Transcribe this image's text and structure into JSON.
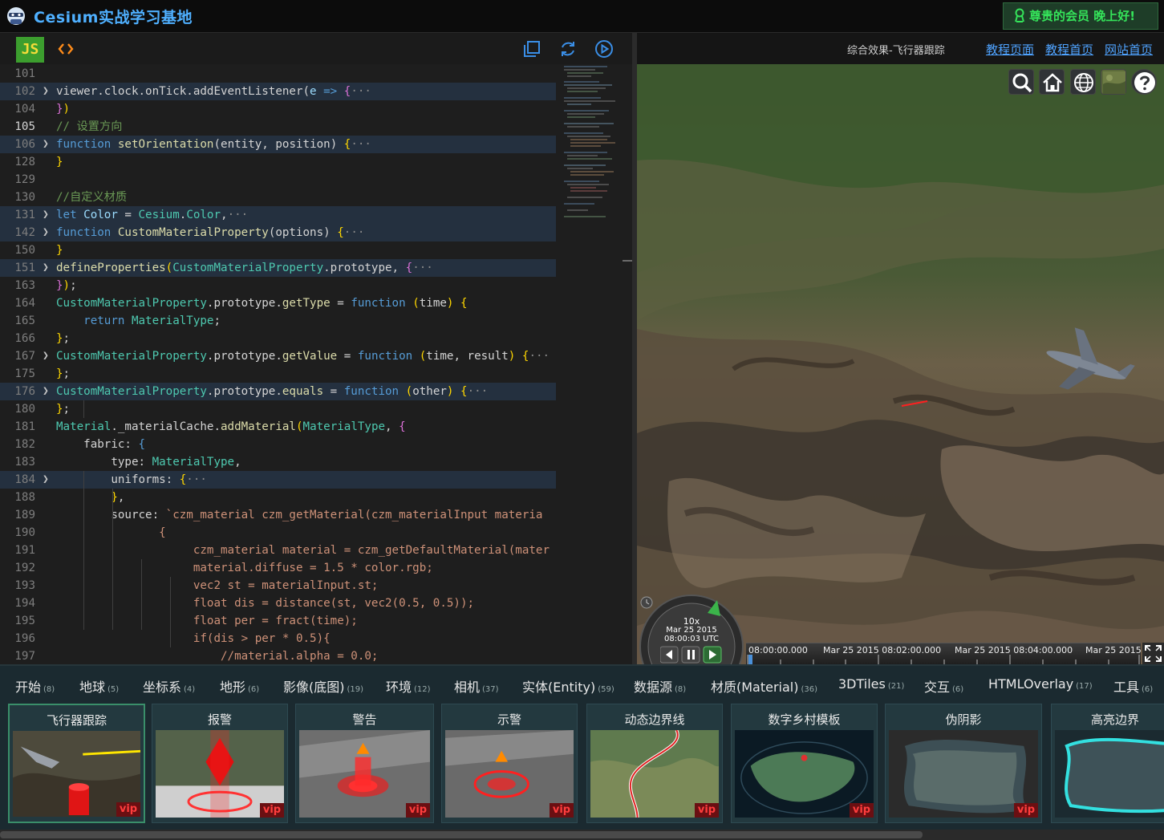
{
  "header": {
    "app_title": "Cesium实战学习基地",
    "member_text": "尊贵的会员 晚上好!",
    "logo_icon": "mascot-logo-icon",
    "member_icon": "user-badge-icon"
  },
  "editor": {
    "lang_badge": "JS",
    "toolbar_icons": [
      "code-icon",
      "copy-icon",
      "refresh-icon",
      "run-icon"
    ],
    "lines": [
      {
        "n": "101",
        "html": ""
      },
      {
        "n": "102",
        "fold": true,
        "hl": true,
        "html": "viewer.clock.onTick.addEventListener(<span class='par'>e</span> <span class='kw'>=&gt;</span> <span class='br2'>{</span><span class='dots'>···</span>"
      },
      {
        "n": "104",
        "html": "<span class='br2'>}</span><span class='br'>)</span>"
      },
      {
        "n": "105",
        "cur": true,
        "html": "<span class='cm'>// 设置方向</span>"
      },
      {
        "n": "106",
        "fold": true,
        "hl": true,
        "html": "<span class='kw'>function</span> <span class='fn'>setOrientation</span>(entity, position) <span class='br'>{</span><span class='dots'>···</span>"
      },
      {
        "n": "128",
        "html": "<span class='br'>}</span>"
      },
      {
        "n": "129",
        "html": ""
      },
      {
        "n": "130",
        "html": "<span class='cm'>//自定义材质</span>"
      },
      {
        "n": "131",
        "fold": true,
        "hl": true,
        "html": "<span class='kw'>let</span> <span class='par'>Color</span> = <span class='cls'>Cesium</span>.<span class='cls'>Color</span>,<span class='dots'>···</span>"
      },
      {
        "n": "142",
        "fold": true,
        "hl": true,
        "html": "<span class='kw'>function</span> <span class='fn'>CustomMaterialProperty</span>(options) <span class='br'>{</span><span class='dots'>···</span>"
      },
      {
        "n": "150",
        "html": "<span class='br'>}</span>"
      },
      {
        "n": "151",
        "fold": true,
        "hl": true,
        "html": "<span class='fn'>defineProperties</span><span class='br'>(</span><span class='cls'>CustomMaterialProperty</span>.prototype, <span class='br2'>{</span><span class='dots'>···</span>"
      },
      {
        "n": "163",
        "html": "<span class='br2'>}</span><span class='br'>)</span>;"
      },
      {
        "n": "164",
        "html": "<span class='cls'>CustomMaterialProperty</span>.prototype.<span class='fn'>getType</span> = <span class='kw'>function</span> <span class='br'>(</span>time<span class='br'>)</span> <span class='br'>{</span>"
      },
      {
        "n": "165",
        "html": "    <span class='kw'>return</span> <span class='cls'>MaterialType</span>;"
      },
      {
        "n": "166",
        "html": "<span class='br'>}</span>;"
      },
      {
        "n": "167",
        "fold": true,
        "html": "<span class='cls'>CustomMaterialProperty</span>.prototype.<span class='fn'>getValue</span> = <span class='kw'>function</span> <span class='br'>(</span>time, result<span class='br'>)</span> <span class='br'>{</span><span class='dots'>···</span>"
      },
      {
        "n": "175",
        "html": "<span class='br'>}</span>;"
      },
      {
        "n": "176",
        "fold": true,
        "hl": true,
        "html": "<span class='cls'>CustomMaterialProperty</span>.prototype.<span class='fn'>equals</span> = <span class='kw'>function</span> <span class='br'>(</span>other<span class='br'>)</span> <span class='br'>{</span><span class='dots'>···</span>"
      },
      {
        "n": "180",
        "html": "<span class='br'>}</span>;"
      },
      {
        "n": "181",
        "html": "<span class='cls'>Material</span>._materialCache.<span class='fn'>addMaterial</span><span class='br'>(</span><span class='cls'>MaterialType</span>, <span class='br2'>{</span>"
      },
      {
        "n": "182",
        "html": "    fabric: <span class='kw'>{</span>"
      },
      {
        "n": "183",
        "html": "        type: <span class='cls'>MaterialType</span>,"
      },
      {
        "n": "184",
        "fold": true,
        "hl": true,
        "html": "        uniforms: <span class='br'>{</span><span class='dots'>···</span>"
      },
      {
        "n": "188",
        "html": "        <span class='br'>}</span>,"
      },
      {
        "n": "189",
        "html": "        source: <span class='str'>`czm_material czm_getMaterial(czm_materialInput materia</span>"
      },
      {
        "n": "190",
        "html": "<span class='str'>               {</span>"
      },
      {
        "n": "191",
        "html": "<span class='str'>                    czm_material material = czm_getDefaultMaterial(mater</span>"
      },
      {
        "n": "192",
        "html": "<span class='str'>                    material.diffuse = 1.5 * color.rgb;</span>"
      },
      {
        "n": "193",
        "html": "<span class='str'>                    vec2 st = materialInput.st;</span>"
      },
      {
        "n": "194",
        "html": "<span class='str'>                    float dis = distance(st, vec2(0.5, 0.5));</span>"
      },
      {
        "n": "195",
        "html": "<span class='str'>                    float per = fract(time);</span>"
      },
      {
        "n": "196",
        "html": "<span class='str'>                    if(dis &gt; per * 0.5){</span>"
      },
      {
        "n": "197",
        "html": "<span class='str'>                        //material.alpha = 0.0;</span>"
      }
    ]
  },
  "viewer": {
    "title": "综合效果-飞行器跟踪",
    "links": [
      "教程页面",
      "教程首页",
      "网站首页"
    ],
    "nav_icons": [
      "search-icon",
      "home-icon",
      "globe-icon",
      "layers-icon",
      "help-icon"
    ],
    "animation": {
      "speed": "10x",
      "date": "Mar 25 2015",
      "time": "08:00:03 UTC"
    },
    "timeline_labels": [
      "08:00:00.000",
      "Mar 25 2015 08:02:00.000",
      "Mar 25 2015 08:04:00.000",
      "Mar 25 2015"
    ]
  },
  "categories": [
    {
      "label": "开始",
      "count": "(8)"
    },
    {
      "label": "地球",
      "count": "(5)"
    },
    {
      "label": "坐标系",
      "count": "(4)"
    },
    {
      "label": "地形",
      "count": "(6)"
    },
    {
      "label": "影像(底图)",
      "count": "(19)"
    },
    {
      "label": "环境",
      "count": "(12)"
    },
    {
      "label": "相机",
      "count": "(37)"
    },
    {
      "label": "实体(Entity)",
      "count": "(59)"
    },
    {
      "label": "数据源",
      "count": "(8)"
    },
    {
      "label": "材质(Material)",
      "count": "(36)"
    },
    {
      "label": "3DTiles",
      "count": "(21)"
    },
    {
      "label": "交互",
      "count": "(6)"
    },
    {
      "label": "HTMLOverlay",
      "count": "(17)"
    },
    {
      "label": "工具",
      "count": "(6)"
    }
  ],
  "cards": [
    {
      "title": "飞行器跟踪",
      "badge": "vip"
    },
    {
      "title": "报警",
      "badge": "vip"
    },
    {
      "title": "警告",
      "badge": "vip"
    },
    {
      "title": "示警",
      "badge": "vip"
    },
    {
      "title": "动态边界线",
      "badge": "vip"
    },
    {
      "title": "数字乡村模板",
      "badge": "vip"
    },
    {
      "title": "伪阴影",
      "badge": "vip"
    },
    {
      "title": "高亮边界",
      "badge": ""
    }
  ]
}
